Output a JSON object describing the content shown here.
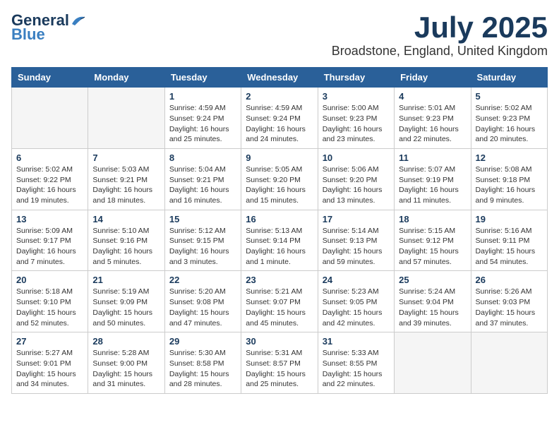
{
  "header": {
    "logo_general": "General",
    "logo_blue": "Blue",
    "month": "July 2025",
    "location": "Broadstone, England, United Kingdom"
  },
  "days_of_week": [
    "Sunday",
    "Monday",
    "Tuesday",
    "Wednesday",
    "Thursday",
    "Friday",
    "Saturday"
  ],
  "weeks": [
    [
      {
        "day": "",
        "info": ""
      },
      {
        "day": "",
        "info": ""
      },
      {
        "day": "1",
        "info": "Sunrise: 4:59 AM\nSunset: 9:24 PM\nDaylight: 16 hours\nand 25 minutes."
      },
      {
        "day": "2",
        "info": "Sunrise: 4:59 AM\nSunset: 9:24 PM\nDaylight: 16 hours\nand 24 minutes."
      },
      {
        "day": "3",
        "info": "Sunrise: 5:00 AM\nSunset: 9:23 PM\nDaylight: 16 hours\nand 23 minutes."
      },
      {
        "day": "4",
        "info": "Sunrise: 5:01 AM\nSunset: 9:23 PM\nDaylight: 16 hours\nand 22 minutes."
      },
      {
        "day": "5",
        "info": "Sunrise: 5:02 AM\nSunset: 9:23 PM\nDaylight: 16 hours\nand 20 minutes."
      }
    ],
    [
      {
        "day": "6",
        "info": "Sunrise: 5:02 AM\nSunset: 9:22 PM\nDaylight: 16 hours\nand 19 minutes."
      },
      {
        "day": "7",
        "info": "Sunrise: 5:03 AM\nSunset: 9:21 PM\nDaylight: 16 hours\nand 18 minutes."
      },
      {
        "day": "8",
        "info": "Sunrise: 5:04 AM\nSunset: 9:21 PM\nDaylight: 16 hours\nand 16 minutes."
      },
      {
        "day": "9",
        "info": "Sunrise: 5:05 AM\nSunset: 9:20 PM\nDaylight: 16 hours\nand 15 minutes."
      },
      {
        "day": "10",
        "info": "Sunrise: 5:06 AM\nSunset: 9:20 PM\nDaylight: 16 hours\nand 13 minutes."
      },
      {
        "day": "11",
        "info": "Sunrise: 5:07 AM\nSunset: 9:19 PM\nDaylight: 16 hours\nand 11 minutes."
      },
      {
        "day": "12",
        "info": "Sunrise: 5:08 AM\nSunset: 9:18 PM\nDaylight: 16 hours\nand 9 minutes."
      }
    ],
    [
      {
        "day": "13",
        "info": "Sunrise: 5:09 AM\nSunset: 9:17 PM\nDaylight: 16 hours\nand 7 minutes."
      },
      {
        "day": "14",
        "info": "Sunrise: 5:10 AM\nSunset: 9:16 PM\nDaylight: 16 hours\nand 5 minutes."
      },
      {
        "day": "15",
        "info": "Sunrise: 5:12 AM\nSunset: 9:15 PM\nDaylight: 16 hours\nand 3 minutes."
      },
      {
        "day": "16",
        "info": "Sunrise: 5:13 AM\nSunset: 9:14 PM\nDaylight: 16 hours\nand 1 minute."
      },
      {
        "day": "17",
        "info": "Sunrise: 5:14 AM\nSunset: 9:13 PM\nDaylight: 15 hours\nand 59 minutes."
      },
      {
        "day": "18",
        "info": "Sunrise: 5:15 AM\nSunset: 9:12 PM\nDaylight: 15 hours\nand 57 minutes."
      },
      {
        "day": "19",
        "info": "Sunrise: 5:16 AM\nSunset: 9:11 PM\nDaylight: 15 hours\nand 54 minutes."
      }
    ],
    [
      {
        "day": "20",
        "info": "Sunrise: 5:18 AM\nSunset: 9:10 PM\nDaylight: 15 hours\nand 52 minutes."
      },
      {
        "day": "21",
        "info": "Sunrise: 5:19 AM\nSunset: 9:09 PM\nDaylight: 15 hours\nand 50 minutes."
      },
      {
        "day": "22",
        "info": "Sunrise: 5:20 AM\nSunset: 9:08 PM\nDaylight: 15 hours\nand 47 minutes."
      },
      {
        "day": "23",
        "info": "Sunrise: 5:21 AM\nSunset: 9:07 PM\nDaylight: 15 hours\nand 45 minutes."
      },
      {
        "day": "24",
        "info": "Sunrise: 5:23 AM\nSunset: 9:05 PM\nDaylight: 15 hours\nand 42 minutes."
      },
      {
        "day": "25",
        "info": "Sunrise: 5:24 AM\nSunset: 9:04 PM\nDaylight: 15 hours\nand 39 minutes."
      },
      {
        "day": "26",
        "info": "Sunrise: 5:26 AM\nSunset: 9:03 PM\nDaylight: 15 hours\nand 37 minutes."
      }
    ],
    [
      {
        "day": "27",
        "info": "Sunrise: 5:27 AM\nSunset: 9:01 PM\nDaylight: 15 hours\nand 34 minutes."
      },
      {
        "day": "28",
        "info": "Sunrise: 5:28 AM\nSunset: 9:00 PM\nDaylight: 15 hours\nand 31 minutes."
      },
      {
        "day": "29",
        "info": "Sunrise: 5:30 AM\nSunset: 8:58 PM\nDaylight: 15 hours\nand 28 minutes."
      },
      {
        "day": "30",
        "info": "Sunrise: 5:31 AM\nSunset: 8:57 PM\nDaylight: 15 hours\nand 25 minutes."
      },
      {
        "day": "31",
        "info": "Sunrise: 5:33 AM\nSunset: 8:55 PM\nDaylight: 15 hours\nand 22 minutes."
      },
      {
        "day": "",
        "info": ""
      },
      {
        "day": "",
        "info": ""
      }
    ]
  ]
}
